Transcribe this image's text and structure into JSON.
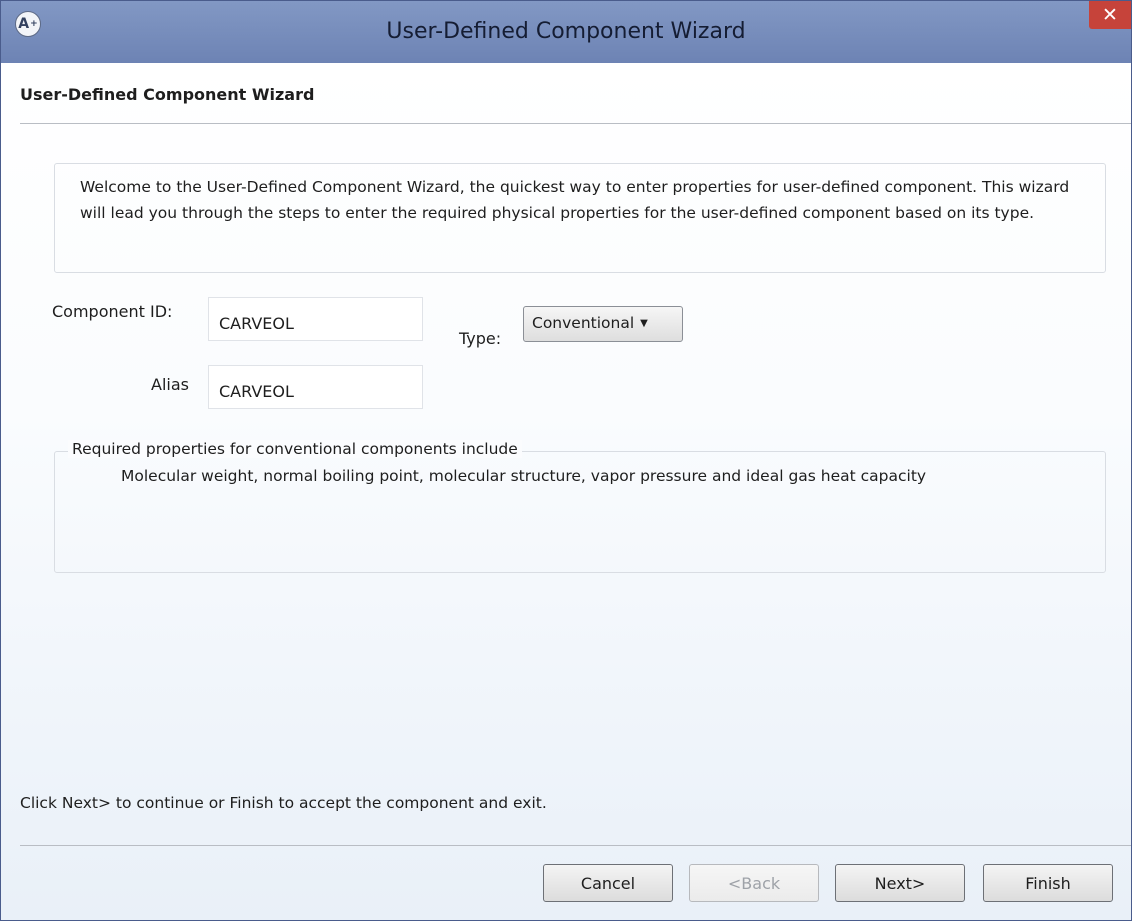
{
  "window": {
    "title": "User-Defined Component Wizard",
    "app_icon_glyph": "A",
    "app_icon_superscript": "+",
    "close_glyph": "✕"
  },
  "header": {
    "title": "User-Defined Component Wizard"
  },
  "welcome": {
    "text": "Welcome to the User-Defined Component Wizard, the quickest way to enter properties for user-defined component.  This wizard will lead you through the steps to enter the required physical properties for the user-defined component based on its type."
  },
  "form": {
    "component_id_label": "Component ID:",
    "component_id_value": "CARVEOL",
    "alias_label": "Alias",
    "alias_value": "CARVEOL",
    "type_label": "Type:",
    "type_value": "Conventional"
  },
  "required": {
    "legend": "Required properties for conventional components include",
    "text": "Molecular weight, normal boiling point, molecular structure, vapor pressure and ideal gas heat capacity"
  },
  "footer": {
    "message": "Click Next> to continue or Finish to accept the component and exit.",
    "cancel_label": "Cancel",
    "back_label": "<Back",
    "next_label": "Next>",
    "finish_label": "Finish"
  },
  "colors": {
    "titlebar": "#7a8fbe",
    "close_button": "#c6433a",
    "content_gradient_end": "#e9f0f8"
  }
}
